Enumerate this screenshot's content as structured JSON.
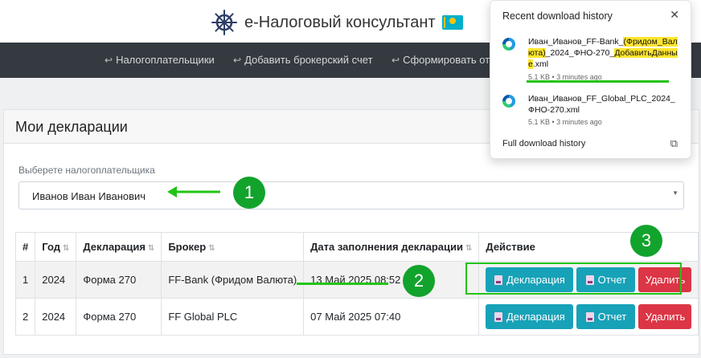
{
  "app": {
    "title": "e-Налоговый консультант"
  },
  "nav": {
    "items": [
      {
        "label": "Налогоплательщики"
      },
      {
        "label": "Добавить брокерский счет"
      },
      {
        "label": "Сформировать отч"
      }
    ]
  },
  "card": {
    "title": "Мои декларации"
  },
  "taxpayer_select": {
    "label": "Выберете налогоплательщика",
    "value": "Иванов Иван Иванович"
  },
  "table": {
    "headers": [
      "#",
      "Год",
      "Декларация",
      "Брокер",
      "Дата заполнения декларации",
      "Действие"
    ],
    "rows": [
      {
        "num": "1",
        "year": "2024",
        "declaration": "Форма 270",
        "broker": "FF-Bank (Фридом Валюта)",
        "date": "13 Май 2025 08:52"
      },
      {
        "num": "2",
        "year": "2024",
        "declaration": "Форма 270",
        "broker": "FF Global PLC",
        "date": "07 Май 2025 07:40"
      }
    ],
    "actions": {
      "declaration": "Декларация",
      "report": "Отчет",
      "delete": "Удалить"
    }
  },
  "annotations": {
    "one": "1",
    "two": "2",
    "three": "3"
  },
  "download_popup": {
    "title": "Recent download history",
    "items": [
      {
        "name_parts": [
          "Иван_Иванов_FF-Bank_",
          "(Фридом_Валюта)",
          "_2024_ФНО-270_",
          "ДобавитьДанные",
          ".xml"
        ],
        "meta": "5.1 KB • 3 minutes ago"
      },
      {
        "name": "Иван_Иванов_FF_Global_PLC_2024_ФНО-270.xml",
        "meta": "5.1 KB • 3 minutes ago"
      }
    ],
    "footer": "Full download history"
  },
  "colors": {
    "nav_bg": "#343a40",
    "info": "#17a2b8",
    "danger": "#dc3545",
    "annotation_green": "#12a32c"
  }
}
